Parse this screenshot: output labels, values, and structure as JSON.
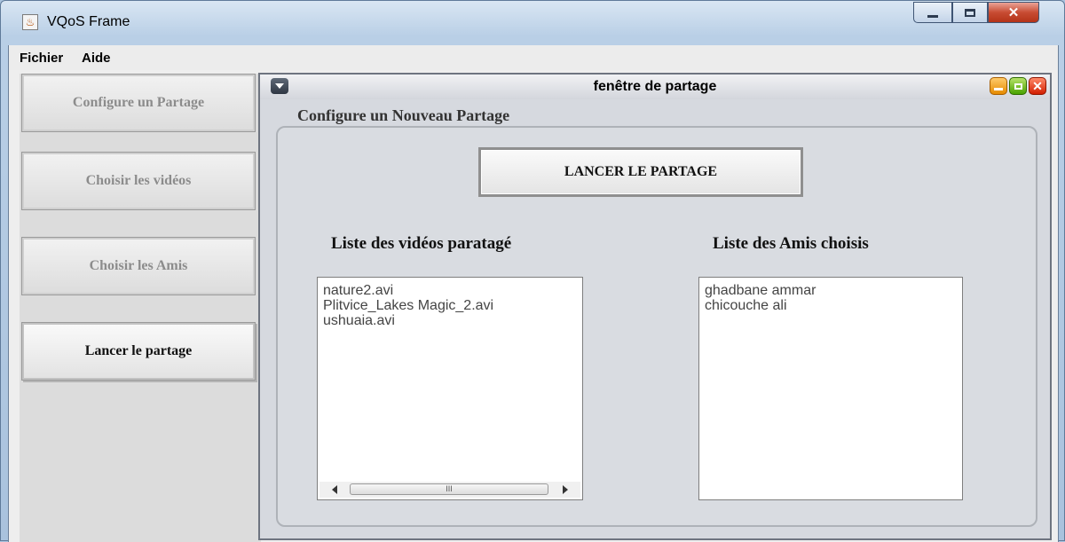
{
  "window": {
    "title": "VQoS Frame",
    "icon": "java-cup-icon",
    "close_glyph": "✕"
  },
  "menubar": {
    "items": [
      "Fichier",
      "Aide"
    ]
  },
  "sidebar": {
    "buttons": [
      {
        "label": "Configure un Partage",
        "enabled": false
      },
      {
        "label": "Choisir les vidéos",
        "enabled": false
      },
      {
        "label": "Choisir les Amis",
        "enabled": false
      },
      {
        "label": "Lancer le partage",
        "enabled": true
      }
    ]
  },
  "internal_frame": {
    "title": "fenêtre de partage",
    "close_glyph": "✕",
    "section_title": "Configure un Nouveau Partage",
    "launch_button": "LANCER LE PARTAGE",
    "videos": {
      "title": "Liste des vidéos paratagé",
      "items": [
        "nature2.avi",
        "Plitvice_Lakes Magic_2.avi",
        "ushuaia.avi"
      ],
      "scroll_thumb_grip": "III"
    },
    "friends": {
      "title": "Liste des Amis choisis",
      "items": [
        "ghadbane ammar",
        "chicouche ali"
      ]
    }
  }
}
